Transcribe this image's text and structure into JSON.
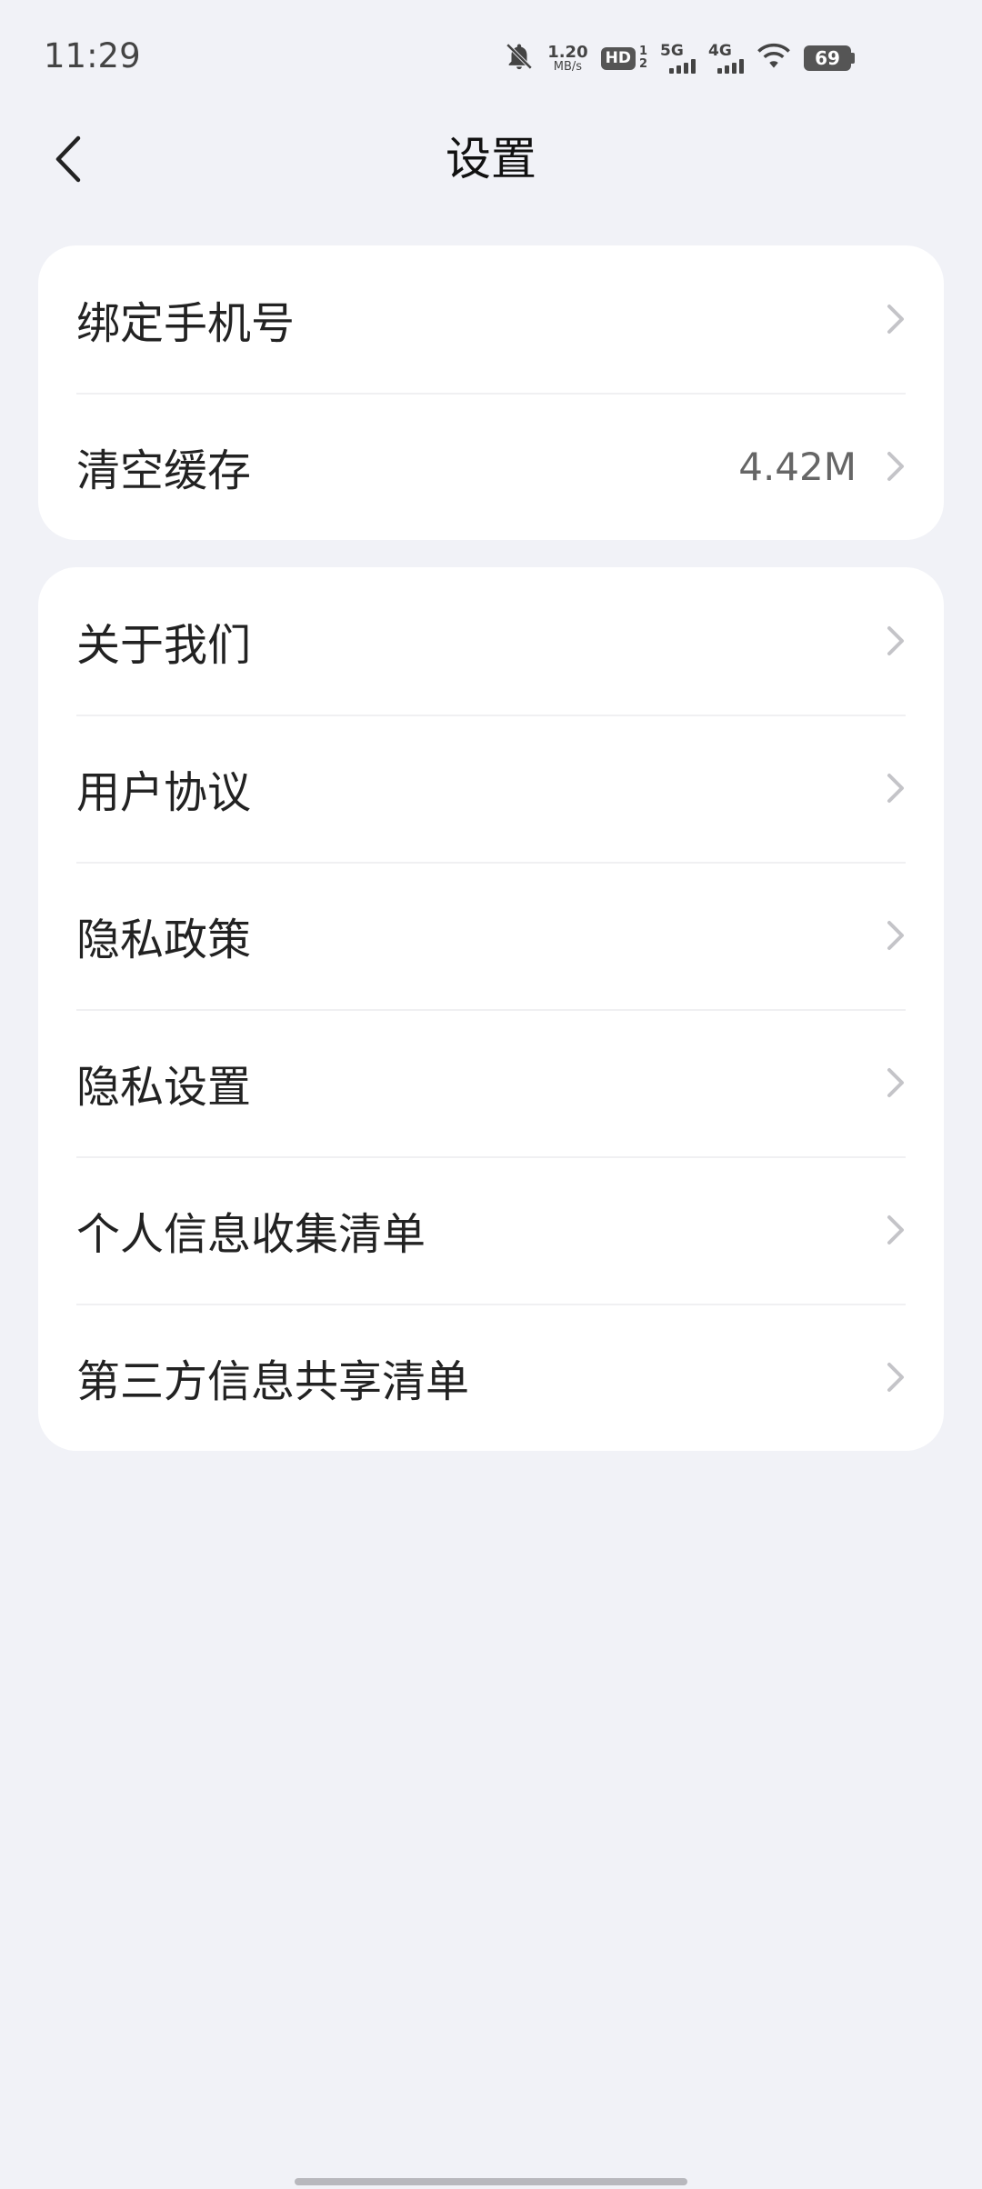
{
  "status_bar": {
    "time": "11:29",
    "net_speed_value": "1.20",
    "net_speed_unit": "MB/s",
    "hd_label": "HD",
    "hd_sub_1": "1",
    "hd_sub_2": "2",
    "network_1": "5G",
    "network_2": "4G",
    "battery": "69"
  },
  "header": {
    "title": "设置"
  },
  "group_1": {
    "items": [
      {
        "label": "绑定手机号",
        "value": ""
      },
      {
        "label": "清空缓存",
        "value": "4.42M"
      }
    ]
  },
  "group_2": {
    "items": [
      {
        "label": "关于我们"
      },
      {
        "label": "用户协议"
      },
      {
        "label": "隐私政策"
      },
      {
        "label": "隐私设置"
      },
      {
        "label": "个人信息收集清单"
      },
      {
        "label": "第三方信息共享清单"
      }
    ]
  },
  "icons": {
    "back": "chevron-left-icon",
    "row_arrow": "chevron-right-icon",
    "silent": "bell-off-icon",
    "wifi": "wifi-icon"
  },
  "colors": {
    "background": "#f1f2f7",
    "card": "#ffffff",
    "chevron": "#c4c4c8"
  }
}
